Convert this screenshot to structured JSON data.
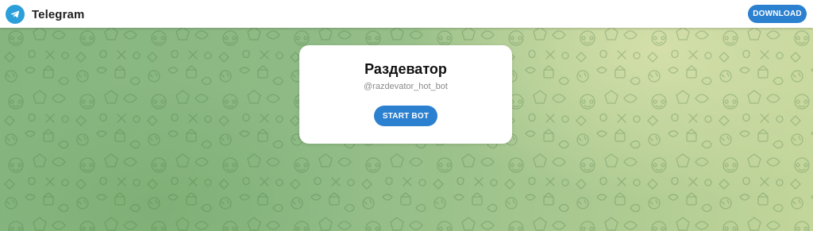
{
  "header": {
    "brand_name": "Telegram",
    "logo_icon": "paper-plane-icon",
    "download_label": "DOWNLOAD"
  },
  "bot_card": {
    "title": "Раздеватор",
    "username": "@razdevator_hot_bot",
    "start_label": "START BOT"
  },
  "colors": {
    "accent": "#2c80d0",
    "logo": "#2b9fd9",
    "background_green": "#8fb98a",
    "background_highlight": "#c3d69b"
  }
}
